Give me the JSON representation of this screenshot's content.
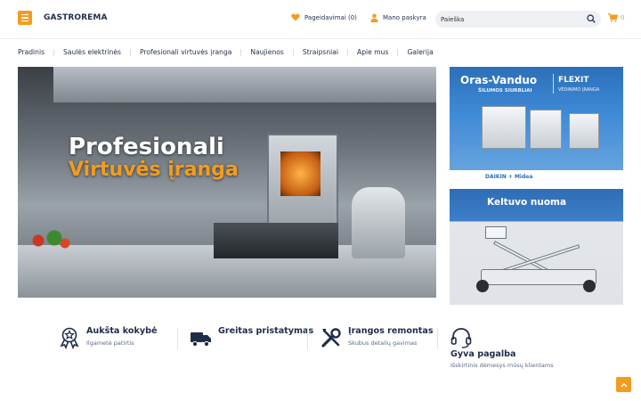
{
  "header": {
    "logo": "GASTROREMA",
    "wishlist_label": "Pageidavimai (0)",
    "account_label": "Mano paskyra",
    "search_placeholder": "Paieška",
    "cart_count": "0"
  },
  "nav": {
    "items": [
      {
        "label": "Pradinis"
      },
      {
        "label": "Saulės elektrinės"
      },
      {
        "label": "Profesionali virtuvės įranga"
      },
      {
        "label": "Naujienos"
      },
      {
        "label": "Straipsniai"
      },
      {
        "label": "Apie mus"
      },
      {
        "label": "Galerija"
      }
    ]
  },
  "hero": {
    "title_line1": "Profesionali",
    "title_line2": "Virtuvės įranga"
  },
  "banners": {
    "heat_pumps": {
      "title": "Oras-Vanduo",
      "subtitle": "ŠILUMOS SIURBLIAI",
      "brand": "FLEXIT",
      "brand_subtitle": "VĖDINIMO ĮRANGA",
      "partner_logos": "DAIKIN + Midea"
    },
    "lift_rental": {
      "title": "Keltuvo nuoma"
    }
  },
  "features": [
    {
      "title": "Aukšta kokybė",
      "desc": "Ilgametė patirtis",
      "icon": "award-icon"
    },
    {
      "title": "Greitas pristatymas",
      "desc": "",
      "icon": "truck-icon"
    },
    {
      "title": "Įrangos remontas",
      "desc": "Skubus detalių gavimas",
      "icon": "tools-icon"
    },
    {
      "title": "Gyva pagalba",
      "desc": "Išskirtinis dėmesys mūsų klientams",
      "icon": "headset-icon"
    }
  ],
  "colors": {
    "accent": "#f39c1f",
    "text": "#1f2d4a"
  }
}
